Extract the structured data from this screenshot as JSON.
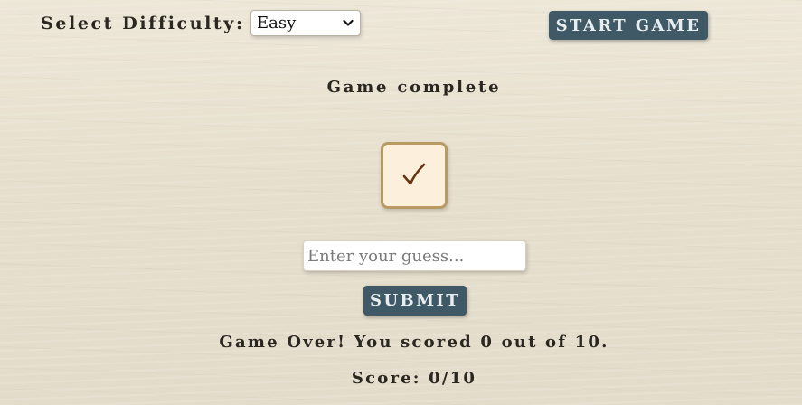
{
  "controls": {
    "difficulty_label": "Select Difficulty:",
    "difficulty_selected": "Easy",
    "start_label": "START GAME"
  },
  "game": {
    "status": "Game complete",
    "tile_icon": "checkmark-icon",
    "guess_placeholder": "Enter your guess...",
    "guess_value": "",
    "submit_label": "SUBMIT",
    "result_message": "Game Over! You scored 0 out of 10.",
    "score_text": "Score: 0/10"
  },
  "colors": {
    "button_bg": "#3f5967",
    "tile_bg": "#fcf0dd",
    "tile_border": "#b89a62",
    "check_color": "#6b3412",
    "background": "#e9e2d1"
  }
}
